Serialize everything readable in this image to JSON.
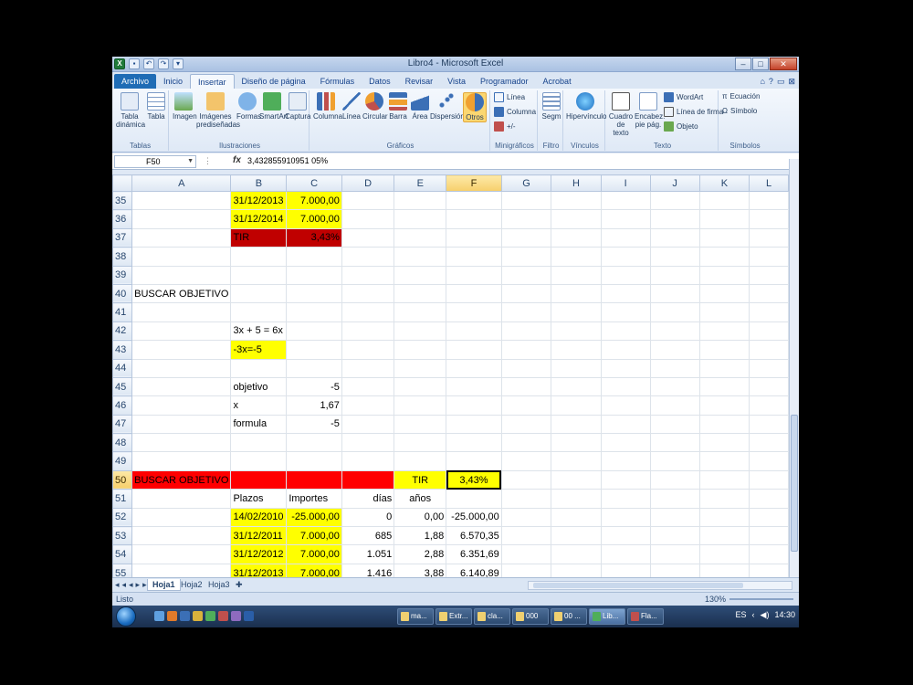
{
  "window": {
    "title": "Libro4 - Microsoft Excel",
    "controls": [
      "–",
      "□",
      "✕"
    ]
  },
  "ribbon": {
    "tabs": [
      "Archivo",
      "Inicio",
      "Insertar",
      "Diseño de página",
      "Fórmulas",
      "Datos",
      "Revisar",
      "Vista",
      "Programador",
      "Acrobat"
    ],
    "active_tab": "Insertar",
    "groups": {
      "tablas": {
        "label": "Tablas",
        "buttons": [
          "Tabla dinámica",
          "Tabla"
        ]
      },
      "ilustraciones": {
        "label": "Ilustraciones",
        "buttons": [
          "Imagen",
          "Imágenes prediseñadas",
          "Formas",
          "SmartArt",
          "Captura"
        ]
      },
      "graficos": {
        "label": "Gráficos",
        "buttons": [
          "Columna",
          "Línea",
          "Circular",
          "Barra",
          "Área",
          "Dispersión",
          "Otros"
        ]
      },
      "minigraficos": {
        "label": "Minigráficos",
        "buttons": [
          "Línea",
          "Columna",
          "+/-"
        ]
      },
      "filtro": {
        "label": "Filtro",
        "buttons": [
          "Segm"
        ]
      },
      "vinculos": {
        "label": "Vínculos",
        "buttons": [
          "Hipervínculo"
        ]
      },
      "texto": {
        "label": "Texto",
        "buttons": [
          "Cuadro de texto",
          "Encabez. pie pág.",
          "WordArt",
          "Línea de firma",
          "Objeto"
        ]
      },
      "simbolos": {
        "label": "Símbolos",
        "buttons": [
          "Ecuación",
          "Símbolo"
        ]
      }
    }
  },
  "formula_bar": {
    "name_box": "F50",
    "fx": "fx",
    "value": "3,432855910951 05%"
  },
  "columns": [
    "A",
    "B",
    "C",
    "D",
    "E",
    "F",
    "G",
    "H",
    "I",
    "J",
    "K",
    "L"
  ],
  "rows": [
    {
      "n": "35",
      "B": "31/12/2013",
      "C": "7.000,00"
    },
    {
      "n": "36",
      "B": "31/12/2014",
      "C": "7.000,00"
    },
    {
      "n": "37",
      "B": "TIR",
      "C": "3,43%"
    },
    {
      "n": "38"
    },
    {
      "n": "39"
    },
    {
      "n": "40",
      "A": "BUSCAR OBJETIVO"
    },
    {
      "n": "41"
    },
    {
      "n": "42",
      "B": "3x + 5 = 6x"
    },
    {
      "n": "43",
      "B": "-3x=-5"
    },
    {
      "n": "44"
    },
    {
      "n": "45",
      "B": "objetivo",
      "C": "-5"
    },
    {
      "n": "46",
      "B": "x",
      "C": "1,67"
    },
    {
      "n": "47",
      "B": "formula",
      "C": "-5"
    },
    {
      "n": "48"
    },
    {
      "n": "49"
    },
    {
      "n": "50",
      "A": "BUSCAR OBJETIVO",
      "E": "TIR",
      "F": "3,43%"
    },
    {
      "n": "51",
      "B": "Plazos",
      "C": "Importes",
      "D": "días",
      "E": "años"
    },
    {
      "n": "52",
      "B": "14/02/2010",
      "C": "-25.000,00",
      "D": "0",
      "E": "0,00",
      "F": "-25.000,00"
    },
    {
      "n": "53",
      "B": "31/12/2011",
      "C": "7.000,00",
      "D": "685",
      "E": "1,88",
      "F": "6.570,35"
    },
    {
      "n": "54",
      "B": "31/12/2012",
      "C": "7.000,00",
      "D": "1.051",
      "E": "2,88",
      "F": "6.351,69"
    },
    {
      "n": "55",
      "B": "31/12/2013",
      "C": "7.000,00",
      "D": "1.416",
      "E": "3,88",
      "F": "6.140,89"
    }
  ],
  "sheets": [
    "Hoja1",
    "Hoja2",
    "Hoja3"
  ],
  "active_sheet": "Hoja1",
  "status": {
    "mode": "Listo",
    "zoom": "130%"
  },
  "taskbar": {
    "items": [
      "ma...",
      "Extr...",
      "cla...",
      "000",
      "00 ...",
      "Lib...",
      "Fla..."
    ],
    "active": "Lib...",
    "lang": "ES",
    "clock": "14:30"
  },
  "colors": {
    "yellow": "#ffff00",
    "red": "#ff0000",
    "dark_red": "#c00000",
    "accent": "#1f6cb5"
  }
}
